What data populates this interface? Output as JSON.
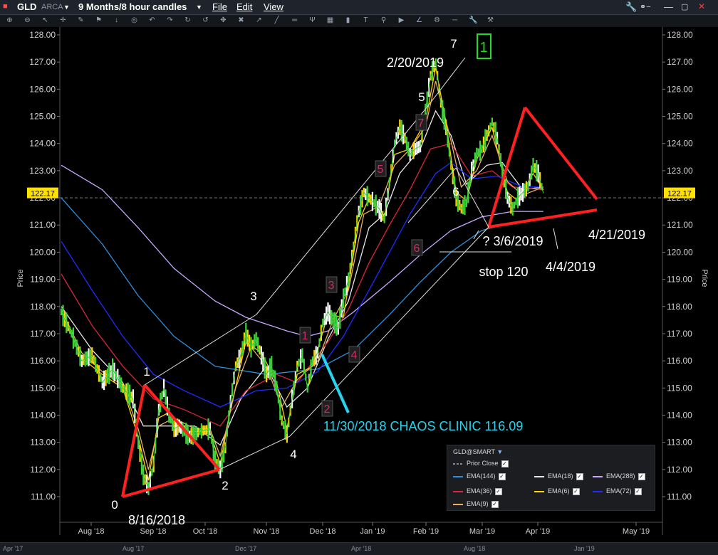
{
  "window": {
    "symbol": "GLD",
    "exchange": "ARCA",
    "period": "9 Months/8 hour candles",
    "menus": [
      "File",
      "Edit",
      "View"
    ]
  },
  "toolbar_icons": [
    "zoom-in-icon",
    "zoom-out-icon",
    "cursor-icon",
    "crosshair-icon",
    "pencil-icon",
    "flag-icon",
    "down-arrow-icon",
    "target-icon",
    "back-icon",
    "forward-icon",
    "redo-icon",
    "undo-icon",
    "pan-icon",
    "cross-icon",
    "arrow-up-right-icon",
    "line-icon",
    "channel-icon",
    "pitchfork-icon",
    "grid-icon",
    "bars-icon",
    "text-icon",
    "search-icon",
    "play-icon",
    "fan-icon",
    "settings-icon",
    "ruler-icon",
    "wrench-icon",
    "tools-icon"
  ],
  "window_controls": [
    "link-icon",
    "minimize-icon",
    "maximize-icon",
    "close-icon"
  ],
  "chart_data": {
    "type": "line",
    "ylabel": "Price",
    "ylim": [
      110.5,
      128.5
    ],
    "y_ticks": [
      "128.00",
      "127.00",
      "126.00",
      "125.00",
      "124.00",
      "123.00",
      "122.00",
      "121.00",
      "120.00",
      "119.00",
      "118.00",
      "117.00",
      "116.00",
      "115.00",
      "114.00",
      "113.00",
      "112.00",
      "111.00"
    ],
    "x_ticks": [
      "Aug '18",
      "Sep '18",
      "Oct '18",
      "Nov '18",
      "Dec '18",
      "Jan '19",
      "Feb '19",
      "Mar '19",
      "Apr '19",
      "May '19"
    ],
    "current_price": "122.17",
    "prior_close": 122.0,
    "price_series_name": "GLD@SMART",
    "price_path": [
      [
        0,
        117.8
      ],
      [
        2,
        117.0
      ],
      [
        4,
        116.0
      ],
      [
        6,
        116.2
      ],
      [
        8,
        115.2
      ],
      [
        10,
        115.7
      ],
      [
        12,
        115.0
      ],
      [
        14,
        114.6
      ],
      [
        15,
        113.0
      ],
      [
        16,
        111.8
      ],
      [
        17,
        111.3
      ],
      [
        18,
        112.2
      ],
      [
        19,
        114.2
      ],
      [
        20,
        115.0
      ],
      [
        21,
        114.0
      ],
      [
        22,
        113.5
      ],
      [
        23,
        113.6
      ],
      [
        25,
        113.2
      ],
      [
        27,
        113.4
      ],
      [
        29,
        113.5
      ],
      [
        30,
        112.3
      ],
      [
        31,
        112.0
      ],
      [
        32,
        112.8
      ],
      [
        33,
        114.5
      ],
      [
        34,
        115.8
      ],
      [
        35,
        116.2
      ],
      [
        36,
        117.0
      ],
      [
        37,
        116.5
      ],
      [
        38,
        116.8
      ],
      [
        39,
        116.2
      ],
      [
        40,
        115.5
      ],
      [
        41,
        115.8
      ],
      [
        42,
        115.0
      ],
      [
        43,
        113.8
      ],
      [
        44,
        113.3
      ],
      [
        45,
        114.6
      ],
      [
        46,
        115.8
      ],
      [
        47,
        116.2
      ],
      [
        48,
        115.0
      ],
      [
        49,
        116.0
      ],
      [
        50,
        116.3
      ],
      [
        51,
        117.4
      ],
      [
        52,
        117.8
      ],
      [
        53,
        117.5
      ],
      [
        54,
        117.2
      ],
      [
        55,
        118.3
      ],
      [
        56,
        119.0
      ],
      [
        57,
        120.2
      ],
      [
        58,
        121.5
      ],
      [
        59,
        122.2
      ],
      [
        60,
        122.0
      ],
      [
        61,
        121.8
      ],
      [
        62,
        121.6
      ],
      [
        63,
        121.2
      ],
      [
        64,
        122.6
      ],
      [
        65,
        124.0
      ],
      [
        66,
        124.6
      ],
      [
        67,
        124.2
      ],
      [
        68,
        123.6
      ],
      [
        69,
        123.8
      ],
      [
        70,
        123.9
      ],
      [
        71,
        125.2
      ],
      [
        72,
        126.5
      ],
      [
        73,
        127.0
      ],
      [
        74,
        125.5
      ],
      [
        75,
        124.6
      ],
      [
        76,
        123.2
      ],
      [
        77,
        122.0
      ],
      [
        78,
        121.6
      ],
      [
        79,
        121.8
      ],
      [
        80,
        123.0
      ],
      [
        81,
        123.6
      ],
      [
        82,
        123.8
      ],
      [
        83,
        124.3
      ],
      [
        84,
        124.8
      ],
      [
        85,
        124.2
      ],
      [
        86,
        123.0
      ],
      [
        87,
        122.0
      ],
      [
        88,
        121.6
      ],
      [
        89,
        122.0
      ],
      [
        90,
        122.2
      ],
      [
        91,
        122.4
      ],
      [
        92,
        123.2
      ],
      [
        93,
        122.9
      ],
      [
        94,
        122.17
      ]
    ],
    "ema_series": [
      {
        "name": "EMA(144)",
        "color": "#2f8fdc",
        "values": [
          [
            0,
            122.0
          ],
          [
            8,
            120.3
          ],
          [
            15,
            118.4
          ],
          [
            22,
            116.9
          ],
          [
            30,
            115.8
          ],
          [
            40,
            115.5
          ],
          [
            50,
            115.7
          ],
          [
            57,
            116.4
          ],
          [
            64,
            117.7
          ],
          [
            70,
            118.9
          ],
          [
            76,
            120.0
          ],
          [
            82,
            120.8
          ],
          [
            88,
            121.1
          ],
          [
            94,
            121.2
          ]
        ]
      },
      {
        "name": "EMA(18)",
        "color": "#e8e8e8",
        "values": [
          [
            0,
            118.0
          ],
          [
            6,
            116.4
          ],
          [
            12,
            115.2
          ],
          [
            16,
            113.6
          ],
          [
            20,
            113.6
          ],
          [
            26,
            113.6
          ],
          [
            31,
            112.9
          ],
          [
            35,
            114.6
          ],
          [
            40,
            115.8
          ],
          [
            44,
            114.3
          ],
          [
            48,
            115.0
          ],
          [
            52,
            116.8
          ],
          [
            56,
            118.2
          ],
          [
            60,
            120.9
          ],
          [
            63,
            121.4
          ],
          [
            66,
            122.9
          ],
          [
            70,
            123.8
          ],
          [
            73,
            125.2
          ],
          [
            76,
            124.3
          ],
          [
            79,
            122.5
          ],
          [
            83,
            123.2
          ],
          [
            86,
            123.3
          ],
          [
            90,
            122.3
          ],
          [
            94,
            122.4
          ]
        ]
      },
      {
        "name": "EMA(288)",
        "color": "#c8a8ff",
        "values": [
          [
            0,
            123.2
          ],
          [
            8,
            122.3
          ],
          [
            15,
            120.9
          ],
          [
            22,
            119.4
          ],
          [
            30,
            118.2
          ],
          [
            36,
            117.6
          ],
          [
            44,
            117.1
          ],
          [
            48,
            116.9
          ],
          [
            52,
            117.1
          ],
          [
            57,
            117.8
          ],
          [
            64,
            118.9
          ],
          [
            70,
            119.9
          ],
          [
            76,
            120.8
          ],
          [
            82,
            121.3
          ],
          [
            88,
            121.5
          ],
          [
            94,
            121.5
          ]
        ]
      },
      {
        "name": "EMA(36)",
        "color": "#d8283a",
        "values": [
          [
            0,
            119.2
          ],
          [
            6,
            117.3
          ],
          [
            12,
            115.8
          ],
          [
            18,
            114.6
          ],
          [
            24,
            114.2
          ],
          [
            31,
            113.6
          ],
          [
            36,
            114.9
          ],
          [
            42,
            115.5
          ],
          [
            46,
            115.2
          ],
          [
            52,
            116.7
          ],
          [
            56,
            117.9
          ],
          [
            60,
            119.6
          ],
          [
            64,
            121.0
          ],
          [
            68,
            122.3
          ],
          [
            72,
            123.8
          ],
          [
            76,
            124.0
          ],
          [
            80,
            122.8
          ],
          [
            84,
            123.0
          ],
          [
            88,
            122.4
          ],
          [
            94,
            122.3
          ]
        ]
      },
      {
        "name": "EMA(6)",
        "color": "#ffd400",
        "values": [
          [
            0,
            117.8
          ],
          [
            4,
            116.1
          ],
          [
            8,
            115.5
          ],
          [
            12,
            115.0
          ],
          [
            15,
            113.2
          ],
          [
            17,
            111.6
          ],
          [
            19,
            113.9
          ],
          [
            21,
            114.1
          ],
          [
            25,
            113.4
          ],
          [
            29,
            113.4
          ],
          [
            31,
            112.2
          ],
          [
            33,
            114.2
          ],
          [
            36,
            116.7
          ],
          [
            39,
            116.3
          ],
          [
            42,
            115.2
          ],
          [
            44,
            113.5
          ],
          [
            46,
            115.5
          ],
          [
            49,
            115.8
          ],
          [
            52,
            117.7
          ],
          [
            55,
            117.6
          ],
          [
            58,
            121.1
          ],
          [
            60,
            122.0
          ],
          [
            63,
            121.3
          ],
          [
            65,
            123.6
          ],
          [
            68,
            123.8
          ],
          [
            71,
            124.8
          ],
          [
            73,
            126.8
          ],
          [
            75,
            124.8
          ],
          [
            77,
            122.2
          ],
          [
            79,
            121.9
          ],
          [
            81,
            123.4
          ],
          [
            84,
            124.6
          ],
          [
            87,
            122.2
          ],
          [
            89,
            121.9
          ],
          [
            92,
            122.9
          ],
          [
            94,
            122.3
          ]
        ]
      },
      {
        "name": "EMA(72)",
        "color": "#1f2cff",
        "values": [
          [
            0,
            120.4
          ],
          [
            6,
            118.6
          ],
          [
            12,
            116.9
          ],
          [
            18,
            115.5
          ],
          [
            24,
            114.9
          ],
          [
            31,
            114.3
          ],
          [
            38,
            114.9
          ],
          [
            44,
            115.0
          ],
          [
            50,
            115.6
          ],
          [
            55,
            116.9
          ],
          [
            60,
            118.6
          ],
          [
            64,
            120.0
          ],
          [
            68,
            121.4
          ],
          [
            73,
            122.9
          ],
          [
            76,
            123.3
          ],
          [
            80,
            122.7
          ],
          [
            85,
            122.8
          ],
          [
            90,
            122.4
          ],
          [
            94,
            122.4
          ]
        ]
      },
      {
        "name": "EMA(9)",
        "color": "#e8b060",
        "values": [
          [
            0,
            117.9
          ],
          [
            4,
            116.3
          ],
          [
            8,
            115.6
          ],
          [
            12,
            115.1
          ],
          [
            15,
            113.5
          ],
          [
            17,
            112.0
          ],
          [
            19,
            113.6
          ],
          [
            22,
            113.9
          ],
          [
            26,
            113.5
          ],
          [
            29,
            113.5
          ],
          [
            31,
            112.5
          ],
          [
            34,
            115.0
          ],
          [
            37,
            116.5
          ],
          [
            40,
            115.8
          ],
          [
            43,
            114.3
          ],
          [
            46,
            115.3
          ],
          [
            50,
            116.0
          ],
          [
            53,
            117.5
          ],
          [
            56,
            118.6
          ],
          [
            59,
            121.4
          ],
          [
            62,
            121.7
          ],
          [
            65,
            123.2
          ],
          [
            68,
            123.8
          ],
          [
            71,
            124.6
          ],
          [
            73,
            126.3
          ],
          [
            76,
            124.1
          ],
          [
            78,
            122.4
          ],
          [
            81,
            123.0
          ],
          [
            84,
            124.3
          ],
          [
            87,
            122.6
          ],
          [
            90,
            122.1
          ],
          [
            94,
            122.4
          ]
        ]
      }
    ],
    "legend": {
      "title": "GLD@SMART",
      "prior_close_label": "Prior Close",
      "items": [
        "EMA(144)",
        "EMA(18)",
        "EMA(288)",
        "EMA(36)",
        "EMA(6)",
        "EMA(72)",
        "EMA(9)"
      ]
    },
    "annotations": {
      "wave_labels": [
        {
          "text": "0",
          "x": 17,
          "y": 110.7
        },
        {
          "text": "1",
          "x": 20,
          "y": 115.4
        },
        {
          "text": "2",
          "x": 31,
          "y": 111.4
        },
        {
          "text": "3",
          "x": 36,
          "y": 118.2
        },
        {
          "text": "4",
          "x": 44,
          "y": 112.6
        },
        {
          "text": "5",
          "x": 66,
          "y": 125.6
        },
        {
          "text": "6",
          "x": 70,
          "y": 122.1
        },
        {
          "text": "7",
          "x": 72,
          "y": 127.6
        }
      ],
      "box_labels": [
        {
          "text": "1",
          "x": 49,
          "y": 117.0
        },
        {
          "text": "2",
          "x": 51,
          "y": 114.2
        },
        {
          "text": "3",
          "x": 54,
          "y": 118.8
        },
        {
          "text": "4",
          "x": 56,
          "y": 116.2
        },
        {
          "text": "5",
          "x": 60,
          "y": 123.1
        },
        {
          "text": "6",
          "x": 65,
          "y": 120.2
        },
        {
          "text": "7",
          "x": 66,
          "y": 124.8
        }
      ],
      "text_labels": [
        {
          "text": "8/16/2018",
          "x": 24,
          "y": 110.1,
          "color": "#ffffff"
        },
        {
          "text": "2/20/2019",
          "x": 65,
          "y": 127.0,
          "color": "#ffffff"
        },
        {
          "text": "? 3/6/2019",
          "x": 82,
          "y": 120.5,
          "color": "#ffffff"
        },
        {
          "text": "stop 120",
          "x": 80,
          "y": 119.4,
          "color": "#ffffff"
        },
        {
          "text": "4/4/2019",
          "x": 91,
          "y": 119.5,
          "color": "#ffffff"
        },
        {
          "text": "4/21/2019",
          "x": 98,
          "y": 120.6,
          "color": "#ffffff"
        },
        {
          "text": "11/30/2018 CHAOS CLINIC 116.09",
          "x": 69,
          "y": 113.6,
          "color": "#27d4ef"
        }
      ],
      "wave_flag": "1"
    }
  }
}
